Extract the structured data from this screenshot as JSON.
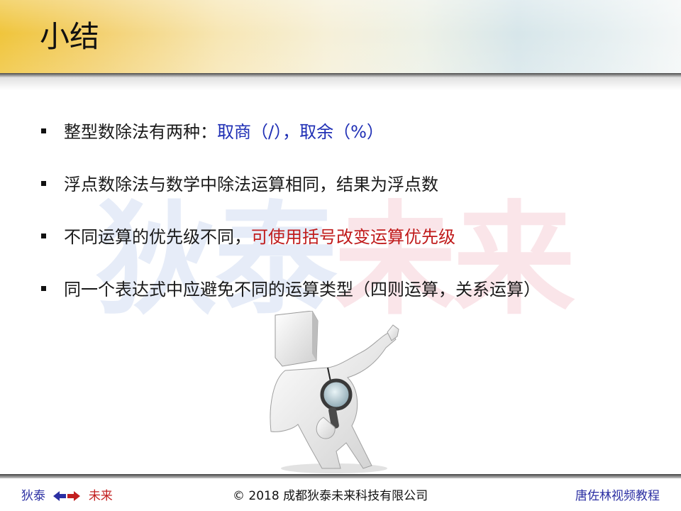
{
  "slide": {
    "title": "小结",
    "watermark": {
      "part_a": "狄泰",
      "part_b": "未来"
    },
    "bullets": [
      {
        "text": "整型数除法有两种：",
        "highlight": "取商（/），取余（%）"
      },
      {
        "text": "浮点数除法与数学中除法运算相同，结果为浮点数"
      },
      {
        "text": "不同运算的优先级不同，",
        "highlight": "可使用括号改变运算优先级"
      },
      {
        "text": "同一个表达式中应避免不同的运算类型（四则运算，关系运算）"
      }
    ],
    "figure_icon": "thinker-with-magnifier-icon"
  },
  "footer": {
    "left_a": "狄泰",
    "left_b": "未来",
    "center": "© 2018 成都狄泰未来科技有限公司",
    "right": "唐佐林视频教程"
  },
  "colors": {
    "title_band_gold": "#f0c53c",
    "highlight_blue": "#1f2fb5",
    "highlight_red": "#c01b1b",
    "footer_blue": "#2b2fa3",
    "footer_red": "#c21f1f"
  }
}
